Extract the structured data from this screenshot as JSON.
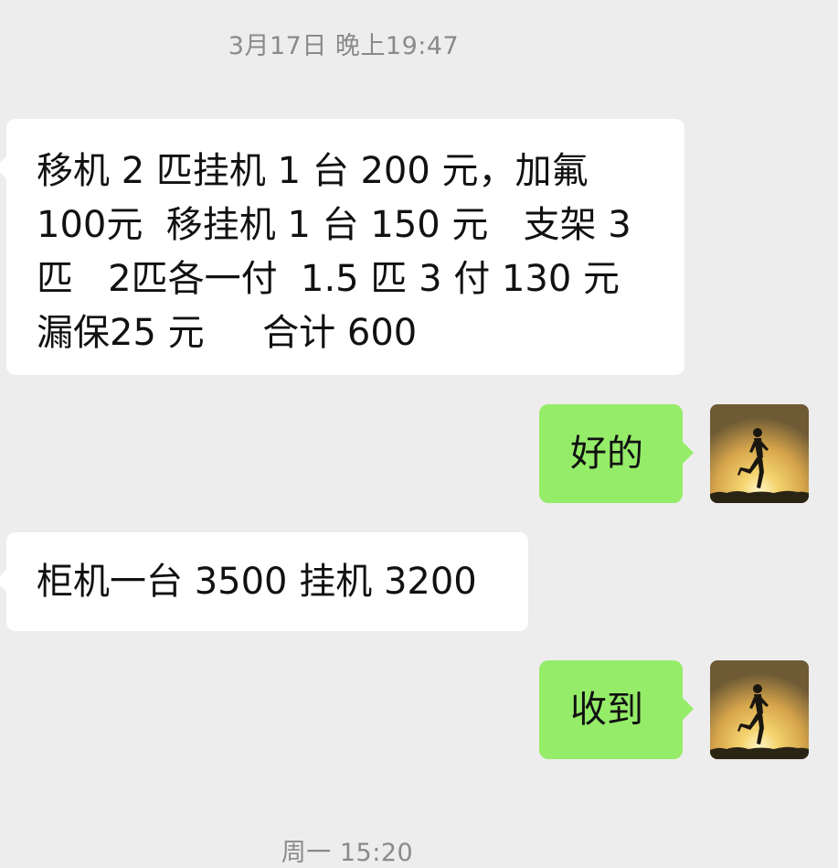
{
  "timestamps": {
    "top": "3月17日 晚上19:47",
    "bottom": "周一 15:20"
  },
  "messages": [
    {
      "side": "incoming",
      "text": "移机 2 匹挂机 1 台 200 元，加氟\n100元  移挂机 1 台 150 元   支架 3\n匹   2匹各一付  1.5 匹 3 付 130 元\n漏保25 元     合计 600"
    },
    {
      "side": "outgoing",
      "text": "好的"
    },
    {
      "side": "incoming",
      "text": "柜机一台 3500 挂机 3200"
    },
    {
      "side": "outgoing",
      "text": "收到"
    }
  ],
  "colors": {
    "background": "#ededed",
    "incoming_bubble": "#ffffff",
    "outgoing_bubble": "#95ec69",
    "timestamp_text": "#8a8a8a"
  },
  "icons": {
    "avatar": "runner-sunset-avatar-icon"
  }
}
